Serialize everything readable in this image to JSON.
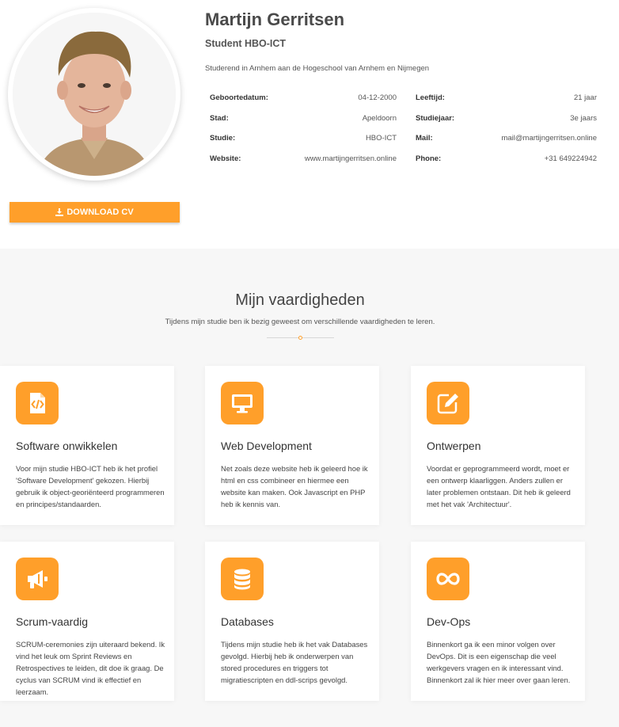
{
  "profile": {
    "name": "Martijn Gerritsen",
    "role": "Student HBO-ICT",
    "intro": "Studerend in Arnhem aan de Hogeschool van Arnhem en Nijmegen",
    "download_label": "DOWNLOAD CV",
    "info_left": [
      {
        "key": "Geboortedatum:",
        "value": "04-12-2000"
      },
      {
        "key": "Stad:",
        "value": "Apeldoorn"
      },
      {
        "key": "Studie:",
        "value": "HBO-ICT"
      },
      {
        "key": "Website:",
        "value": "www.martijngerritsen.online"
      }
    ],
    "info_right": [
      {
        "key": "Leeftijd:",
        "value": "21 jaar"
      },
      {
        "key": "Studiejaar:",
        "value": "3e jaars"
      },
      {
        "key": "Mail:",
        "value": "mail@martijngerritsen.online"
      },
      {
        "key": "Phone:",
        "value": "+31 649224942"
      }
    ]
  },
  "skills": {
    "title": "Mijn vaardigheden",
    "subtitle": "Tijdens mijn studie ben ik bezig geweest om verschillende vaardigheden te leren.",
    "cards": [
      {
        "icon": "code-file-icon",
        "title": "Software onwikkelen",
        "text": "Voor mijn studie HBO-ICT heb ik het profiel 'Software Development' gekozen. Hierbij gebruik ik object-georiënteerd programmeren en principes/standaarden."
      },
      {
        "icon": "desktop-icon",
        "title": "Web Development",
        "text": "Net zoals deze website heb ik geleerd hoe ik html en css combineer en hiermee een website kan maken. Ook Javascript en PHP heb ik kennis van."
      },
      {
        "icon": "edit-icon",
        "title": "Ontwerpen",
        "text": "Voordat er geprogrammeerd wordt, moet er een ontwerp klaarliggen. Anders zullen er later problemen ontstaan. Dit heb ik geleerd met het vak 'Architectuur'."
      },
      {
        "icon": "megaphone-icon",
        "title": "Scrum-vaardig",
        "text": "SCRUM-ceremonies zijn uiteraard bekend. Ik vind het leuk om Sprint Reviews en Retrospectives te leiden, dit doe ik graag. De cyclus van SCRUM vind ik effectief en leerzaam."
      },
      {
        "icon": "database-icon",
        "title": "Databases",
        "text": "Tijdens mijn studie heb ik het vak Databases gevolgd. Hierbij heb ik onderwerpen van stored procedures en triggers tot migratiescripten en ddl-scrips gevolgd."
      },
      {
        "icon": "infinity-icon",
        "title": "Dev-Ops",
        "text": "Binnenkort ga ik een minor volgen over DevOps. Dit is een eigenschap die veel werkgevers vragen en ik interessant vind. Binnenkort zal ik hier meer over gaan leren."
      }
    ]
  },
  "colors": {
    "accent": "#ff9f2a",
    "section_bg": "#f7f7f7"
  }
}
